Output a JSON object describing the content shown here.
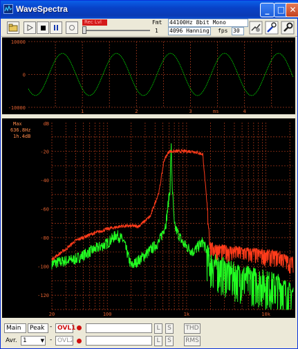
{
  "window": {
    "title": "WaveSpectra",
    "controls": [
      "_",
      "□",
      "✕"
    ]
  },
  "toolbar": {
    "rec_label": "Rec Lvl",
    "format_label": "Fmt",
    "format_value": "44100Hz  8bit Mono",
    "ch_label": "1",
    "window_value": "4096 Hanning",
    "fps_label": "fps",
    "fps_value": "30",
    "icons": [
      "open-icon",
      "play-icon",
      "stop-icon",
      "pause-icon",
      "record-icon",
      "settings-icon",
      "tools-icon"
    ]
  },
  "wave": {
    "y_labels": [
      "10000",
      "0",
      "-10000"
    ],
    "x_ticks": [
      "1",
      "2",
      "3",
      "4"
    ],
    "x_unit": "ms",
    "color": "#00cc00",
    "chart_data": {
      "type": "line",
      "title": "",
      "xlabel": "ms",
      "ylabel": "",
      "xlim": [
        0,
        4.9
      ],
      "ylim": [
        -10000,
        10000
      ],
      "x_ticks": [
        1,
        2,
        3,
        4
      ],
      "y_ticks": [
        10000,
        0,
        -10000
      ],
      "series": [
        {
          "function": "sine",
          "amplitude": 6400,
          "period_ms": 1.0,
          "phase_ms": 0.38
        }
      ],
      "grid": true
    }
  },
  "spectrum": {
    "readout_label": "Max",
    "readout_freq": "636.8Hz",
    "readout_level": "1h.4dB",
    "db_label": "dB",
    "y_labels": [
      "-20",
      "-40",
      "-60",
      "-80",
      "-100",
      "-120"
    ],
    "x_labels": [
      "20",
      "100",
      "1k",
      "10k"
    ],
    "colors": {
      "main": "#ff3b1a",
      "peak": "#22ff22",
      "grid": "#b03a1a",
      "readout": "#ff8a4a"
    },
    "chart_data": {
      "type": "line",
      "title": "",
      "xlabel": "",
      "ylabel": "dB",
      "xscale": "log",
      "xlim": [
        20,
        22050
      ],
      "ylim": [
        -130,
        0
      ],
      "x_ticks": [
        20,
        100,
        1000,
        10000
      ],
      "y_ticks": [
        -20,
        -40,
        -60,
        -80,
        -100,
        -120
      ],
      "series": [
        {
          "name": "Main",
          "color": "#ff3b1a",
          "points": [
            [
              20,
              -95
            ],
            [
              30,
              -88
            ],
            [
              40,
              -82
            ],
            [
              60,
              -78
            ],
            [
              100,
              -74
            ],
            [
              150,
              -72
            ],
            [
              250,
              -72
            ],
            [
              350,
              -65
            ],
            [
              450,
              -48
            ],
            [
              520,
              -26
            ],
            [
              600,
              -20
            ],
            [
              800,
              -20
            ],
            [
              1200,
              -20
            ],
            [
              1600,
              -22
            ],
            [
              2000,
              -86
            ],
            [
              3000,
              -88
            ],
            [
              5000,
              -89
            ],
            [
              10000,
              -91
            ],
            [
              15000,
              -92
            ],
            [
              20000,
              -96
            ]
          ]
        },
        {
          "name": "Peak",
          "color": "#22ff22",
          "points": [
            [
              20,
              -98
            ],
            [
              40,
              -95
            ],
            [
              70,
              -88
            ],
            [
              100,
              -84
            ],
            [
              130,
              -78
            ],
            [
              160,
              -82
            ],
            [
              200,
              -100
            ],
            [
              300,
              -92
            ],
            [
              450,
              -83
            ],
            [
              550,
              -70
            ],
            [
              620,
              -45
            ],
            [
              637,
              -15
            ],
            [
              660,
              -45
            ],
            [
              700,
              -72
            ],
            [
              900,
              -84
            ],
            [
              1200,
              -90
            ],
            [
              1600,
              -83
            ],
            [
              2000,
              -96
            ],
            [
              4000,
              -104
            ],
            [
              8000,
              -108
            ],
            [
              15000,
              -112
            ],
            [
              20000,
              -118
            ]
          ]
        }
      ],
      "grid": true
    }
  },
  "bottom": {
    "main_tab": "Main",
    "peak_tab": "Peak",
    "ovl_label": "OVL1",
    "avr_label": "Avr.",
    "avr_value": "1",
    "ovl2_label": "OVL2",
    "l_label": "L",
    "s_label": "S",
    "thd_label": "THD",
    "rms_label": "RMS"
  }
}
